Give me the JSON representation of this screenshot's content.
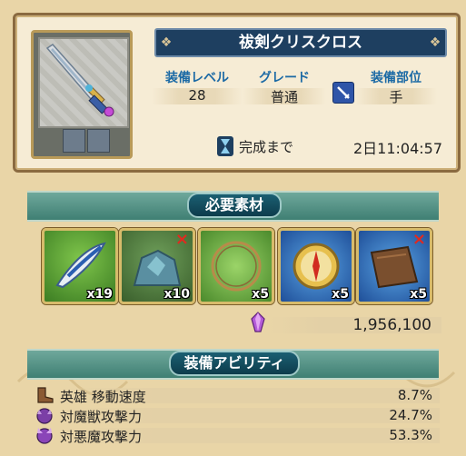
{
  "item": {
    "name": "祓剣クリスクロス",
    "icon": "sword-icon"
  },
  "stats": {
    "level_label": "装備レベル",
    "level_value": "28",
    "grade_label": "グレード",
    "grade_value": "普通",
    "slot_label": "装備部位",
    "slot_value": "手",
    "slot_icon": "sword-slot-icon"
  },
  "timer": {
    "label": "完成まで",
    "value": "2日11:04:57",
    "icon": "hourglass-icon"
  },
  "materials": {
    "header": "必要素材",
    "items": [
      {
        "icon": "feather-icon",
        "qty": "x19",
        "missing": false
      },
      {
        "icon": "ore-icon",
        "qty": "x10",
        "missing": true
      },
      {
        "icon": "ring-icon",
        "qty": "x5",
        "missing": false
      },
      {
        "icon": "compass-icon",
        "qty": "x5",
        "missing": false
      },
      {
        "icon": "leather-icon",
        "qty": "x5",
        "missing": true
      }
    ],
    "missing_mark": "×",
    "cost_icon": "crystal-icon",
    "cost_value": "1,956,100"
  },
  "abilities": {
    "header": "装備アビリティ",
    "rows": [
      {
        "icon": "boot-icon",
        "name": "英雄 移動速度",
        "value": "8.7%"
      },
      {
        "icon": "demon-beast-icon",
        "name": "対魔獣攻撃力",
        "value": "24.7%"
      },
      {
        "icon": "demon-icon",
        "name": "対悪魔攻撃力",
        "value": "53.3%"
      }
    ]
  },
  "colors": {
    "background": "#e9d5a7",
    "title_bar": "#1e3f60",
    "label_blue": "#1c6aa5",
    "section_teal": "#3f7f73",
    "missing_red": "#e2291f"
  }
}
